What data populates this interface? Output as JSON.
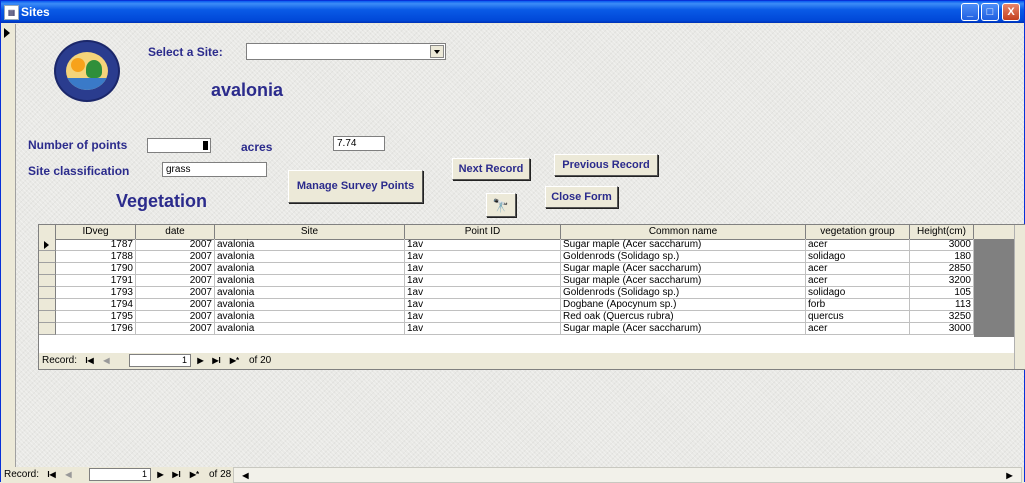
{
  "window": {
    "title": "Sites",
    "icon": "form-icon",
    "minimize": "_",
    "restore": "□",
    "close": "X"
  },
  "form": {
    "select_site_label": "Select a Site:",
    "select_site_value": "",
    "site_name": "avalonia",
    "num_points_label": "Number of points",
    "num_points_value": "",
    "acres_label": "acres",
    "acres_value": "7.74",
    "classification_label": "Site classification",
    "classification_value": "grass",
    "vegetation_heading": "Vegetation",
    "buttons": {
      "manage_survey_points": "Manage Survey Points",
      "next_record": "Next Record",
      "previous_record": "Previous Record",
      "find_icon": "binoculars-icon",
      "close_form": "Close Form"
    }
  },
  "grid": {
    "columns": [
      "IDveg",
      "date",
      "Site",
      "Point ID",
      "Common name",
      "vegetation group",
      "Height(cm)"
    ],
    "rows": [
      [
        "1787",
        "2007",
        "avalonia",
        "1av",
        "Sugar maple (Acer saccharum)",
        "acer",
        "3000"
      ],
      [
        "1788",
        "2007",
        "avalonia",
        "1av",
        "Goldenrods (Solidago sp.)",
        "solidago",
        "180"
      ],
      [
        "1790",
        "2007",
        "avalonia",
        "1av",
        "Sugar maple (Acer saccharum)",
        "acer",
        "2850"
      ],
      [
        "1791",
        "2007",
        "avalonia",
        "1av",
        "Sugar maple (Acer saccharum)",
        "acer",
        "3200"
      ],
      [
        "1793",
        "2007",
        "avalonia",
        "1av",
        "Goldenrods (Solidago sp.)",
        "solidago",
        "105"
      ],
      [
        "1794",
        "2007",
        "avalonia",
        "1av",
        "Dogbane (Apocynum sp.)",
        "forb",
        "113"
      ],
      [
        "1795",
        "2007",
        "avalonia",
        "1av",
        "Red oak (Quercus rubra)",
        "quercus",
        "3250"
      ],
      [
        "1796",
        "2007",
        "avalonia",
        "1av",
        "Sugar maple (Acer saccharum)",
        "acer",
        "3000"
      ]
    ],
    "nav": {
      "label": "Record:",
      "current": "1",
      "of_text": "of 20"
    }
  },
  "main_nav": {
    "label": "Record:",
    "current": "1",
    "of_text": "of 28"
  },
  "nav_glyphs": {
    "first": "I◀",
    "prev": "◀",
    "next": "▶",
    "last": "▶I",
    "new": "▶*"
  },
  "scroll_glyphs": {
    "left": "◀",
    "right": "▶"
  }
}
